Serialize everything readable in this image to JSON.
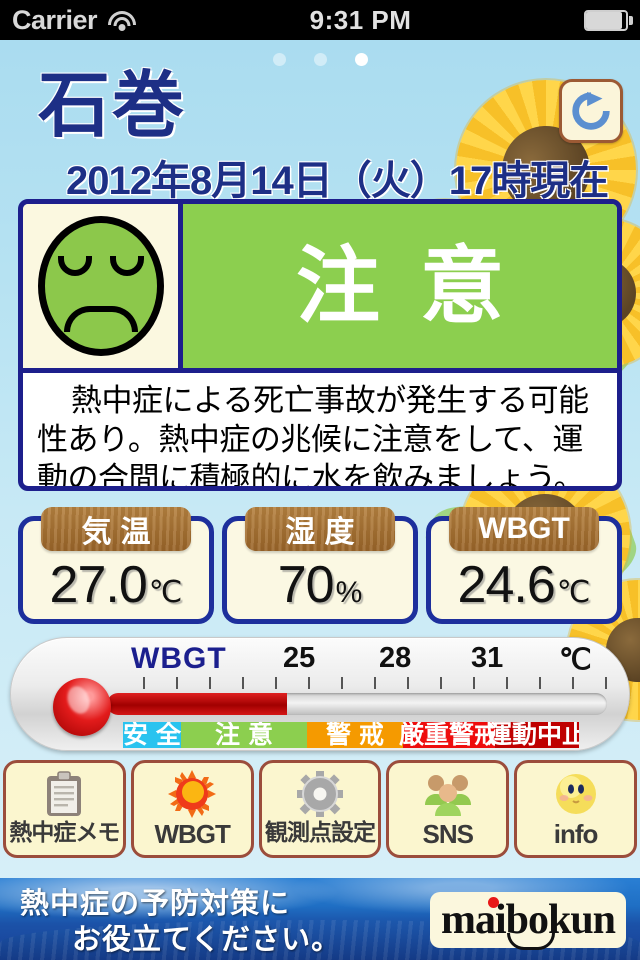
{
  "statusbar": {
    "carrier": "Carrier",
    "time": "9:31 PM",
    "wifi_icon": "wifi-icon",
    "battery_icon": "battery-icon"
  },
  "header": {
    "city": "石巻",
    "datetime": "2012年8月14日（火）17時現在",
    "refresh_icon": "refresh-icon",
    "page_dots": 3,
    "active_dot": 3
  },
  "alert": {
    "face_icon": "sad-face-icon",
    "level": "注意",
    "level_color": "#8ccf4f",
    "description": "熱中症による死亡事故が発生する可能性あり。熱中症の兆候に注意をして、運動の合間に積極的に水を飲みましょう。"
  },
  "metrics": [
    {
      "label": "気温",
      "value": "27.0",
      "unit": "℃"
    },
    {
      "label": "湿度",
      "value": "70",
      "unit": "%"
    },
    {
      "label": "WBGT",
      "value": "24.6",
      "unit": "℃"
    }
  ],
  "thermometer": {
    "title": "WBGT",
    "unit": "℃",
    "tick_labels": [
      "25",
      "28",
      "31"
    ],
    "fill_percent": 36,
    "zones": [
      {
        "label": "安全",
        "color": "#29c3ef"
      },
      {
        "label": "注意",
        "color": "#8ccf4f"
      },
      {
        "label": "警戒",
        "color": "#f59a00"
      },
      {
        "label": "厳重警戒",
        "color": "#ee0d0d"
      },
      {
        "label": "運動中止",
        "color": "#bf0000"
      }
    ]
  },
  "toolbar": [
    {
      "label": "熱中症メモ",
      "icon": "clipboard-icon",
      "ascii": false
    },
    {
      "label": "WBGT",
      "icon": "sun-icon",
      "ascii": true
    },
    {
      "label": "観測点設定",
      "icon": "gear-icon",
      "ascii": false
    },
    {
      "label": "SNS",
      "icon": "people-icon",
      "ascii": true
    },
    {
      "label": "info",
      "icon": "smiley-icon",
      "ascii": true
    }
  ],
  "footer": {
    "line1": "熱中症の予防対策に",
    "line2": "お役立てください。",
    "logo": "maibokun"
  }
}
